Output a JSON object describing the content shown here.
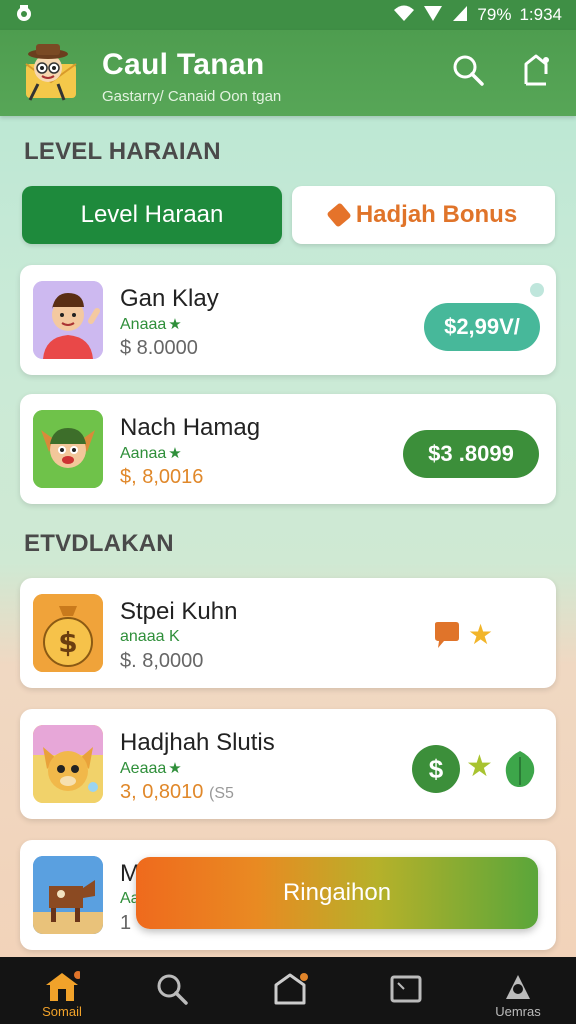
{
  "status_bar": {
    "battery": "79%",
    "time": "1:934"
  },
  "app": {
    "title": "Caul Tanan",
    "subtitle": "Gastarry/ Canaid Oon tgan"
  },
  "section1": {
    "title": "LEVEL HARAIAN"
  },
  "tabs": [
    {
      "label": "Level Haraan",
      "active": true
    },
    {
      "label": "Hadjah Bonus",
      "active": false
    }
  ],
  "section2": {
    "title": "ETVDLAKAN"
  },
  "cards": [
    {
      "name": "Gan Klay",
      "sub": "Anaaa",
      "price": "$ 8.0000",
      "button": "$2,99V/"
    },
    {
      "name": "Nach Hamag",
      "sub": "Aanaa",
      "price": "$, 8,0016",
      "button": "$3 .8099"
    },
    {
      "name": "Stpei Kuhn",
      "sub": "anaaa K",
      "price": "$. 8,0000"
    },
    {
      "name": "Hadjhah Slutis",
      "sub": "Aeaaa",
      "price": "3, 0,8010",
      "price_extra": "(S5"
    },
    {
      "name": "M",
      "sub": "Aa",
      "price": "1"
    }
  ],
  "cta": {
    "label": "Ringaihon"
  },
  "bottom_nav": [
    {
      "label": "Somail",
      "icon": "home-icon",
      "active": true
    },
    {
      "label": "",
      "icon": "search-icon"
    },
    {
      "label": "",
      "icon": "house-outline-icon"
    },
    {
      "label": "",
      "icon": "picture-icon"
    },
    {
      "label": "Uemras",
      "icon": "profile-icon"
    }
  ],
  "colors": {
    "app_bar": "#4e9d4f",
    "active_tab": "#1e8a3c",
    "price_pill_teal": "#47b89a",
    "price_pill_green": "#3c8f3a",
    "bonus_orange": "#e0742a"
  }
}
